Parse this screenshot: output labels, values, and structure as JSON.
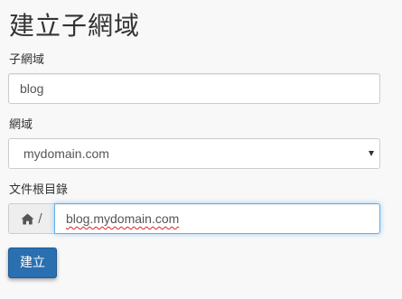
{
  "page": {
    "title": "建立子網域"
  },
  "subdomain": {
    "label": "子網域",
    "value": "blog"
  },
  "domain": {
    "label": "網域",
    "selected": "mydomain.com"
  },
  "document_root": {
    "label": "文件根目錄",
    "prefix_icon": "home-icon",
    "prefix_separator": "/",
    "value": "blog.mydomain.com"
  },
  "actions": {
    "create_label": "建立"
  },
  "colors": {
    "background": "#f8f8f8",
    "primary_button": "#2a6fb0",
    "focus_border": "#66afe9",
    "addon_background": "#eeeeee",
    "spellcheck_underline": "#e02020"
  }
}
